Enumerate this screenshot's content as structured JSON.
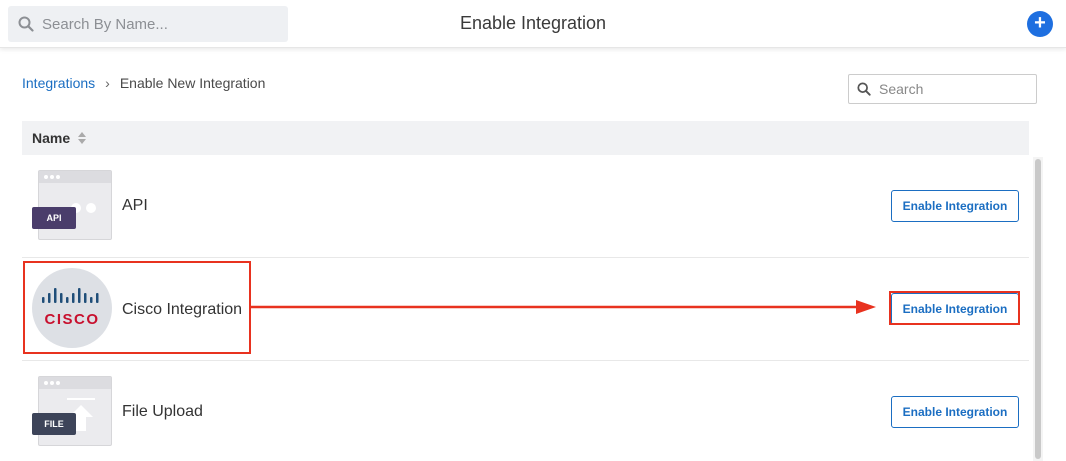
{
  "header": {
    "search_placeholder": "Search By Name...",
    "title": "Enable Integration",
    "add_button_label": "+"
  },
  "breadcrumb": {
    "parent": "Integrations",
    "separator": "›",
    "current": "Enable New Integration"
  },
  "list_search": {
    "placeholder": "Search"
  },
  "table": {
    "column_name": "Name",
    "rows": [
      {
        "name": "API",
        "icon": "api-icon",
        "tag": "API",
        "action": "Enable Integration"
      },
      {
        "name": "Cisco Integration",
        "icon": "cisco-logo",
        "action": "Enable Integration"
      },
      {
        "name": "File Upload",
        "icon": "file-upload-icon",
        "tag": "FILE",
        "action": "Enable Integration"
      }
    ]
  },
  "colors": {
    "accent": "#1b6ec2",
    "add_button": "#1e6fe0",
    "annotation": "#e8321f",
    "api_tag": "#4a3d6b",
    "file_tag": "#3d4459",
    "cisco_red": "#c8102e",
    "cisco_blue": "#1f4e79"
  }
}
